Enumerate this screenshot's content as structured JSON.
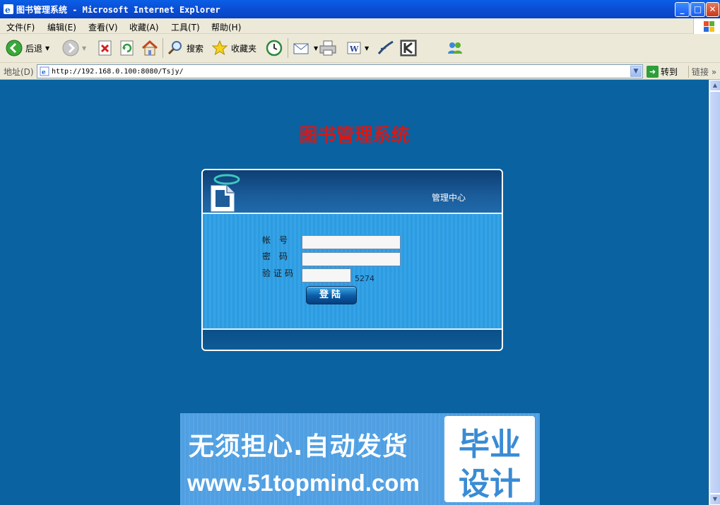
{
  "window": {
    "title": "图书管理系统 - Microsoft Internet Explorer",
    "minimize": "_",
    "maximize": "□",
    "close": "✕"
  },
  "menu": [
    "文件(F)",
    "编辑(E)",
    "查看(V)",
    "收藏(A)",
    "工具(T)",
    "帮助(H)"
  ],
  "toolbar": {
    "back_label": "后退",
    "search_label": "搜索",
    "favorites_label": "收藏夹"
  },
  "address": {
    "label": "地址(D)",
    "url": "http://192.168.0.100:8080/Tsjy/",
    "go_label": "转到",
    "links_label": "链接"
  },
  "page": {
    "system_title": "图书管理系统",
    "header_label": "管理中心",
    "account_label": "帐　号",
    "password_label": "密　码",
    "captcha_label": "验证码",
    "captcha_code": "5274",
    "login_button": "登陆",
    "account_value": "",
    "password_value": "",
    "captcha_value": ""
  },
  "banner": {
    "slogan": "无须担心.自动发货",
    "url": "www.51topmind.com",
    "badge_line1": "毕业",
    "badge_line2": "设计"
  },
  "colors": {
    "page_bg": "#0a62a0",
    "title_red": "#d21a1a",
    "banner_blue": "#4f9fe2"
  }
}
